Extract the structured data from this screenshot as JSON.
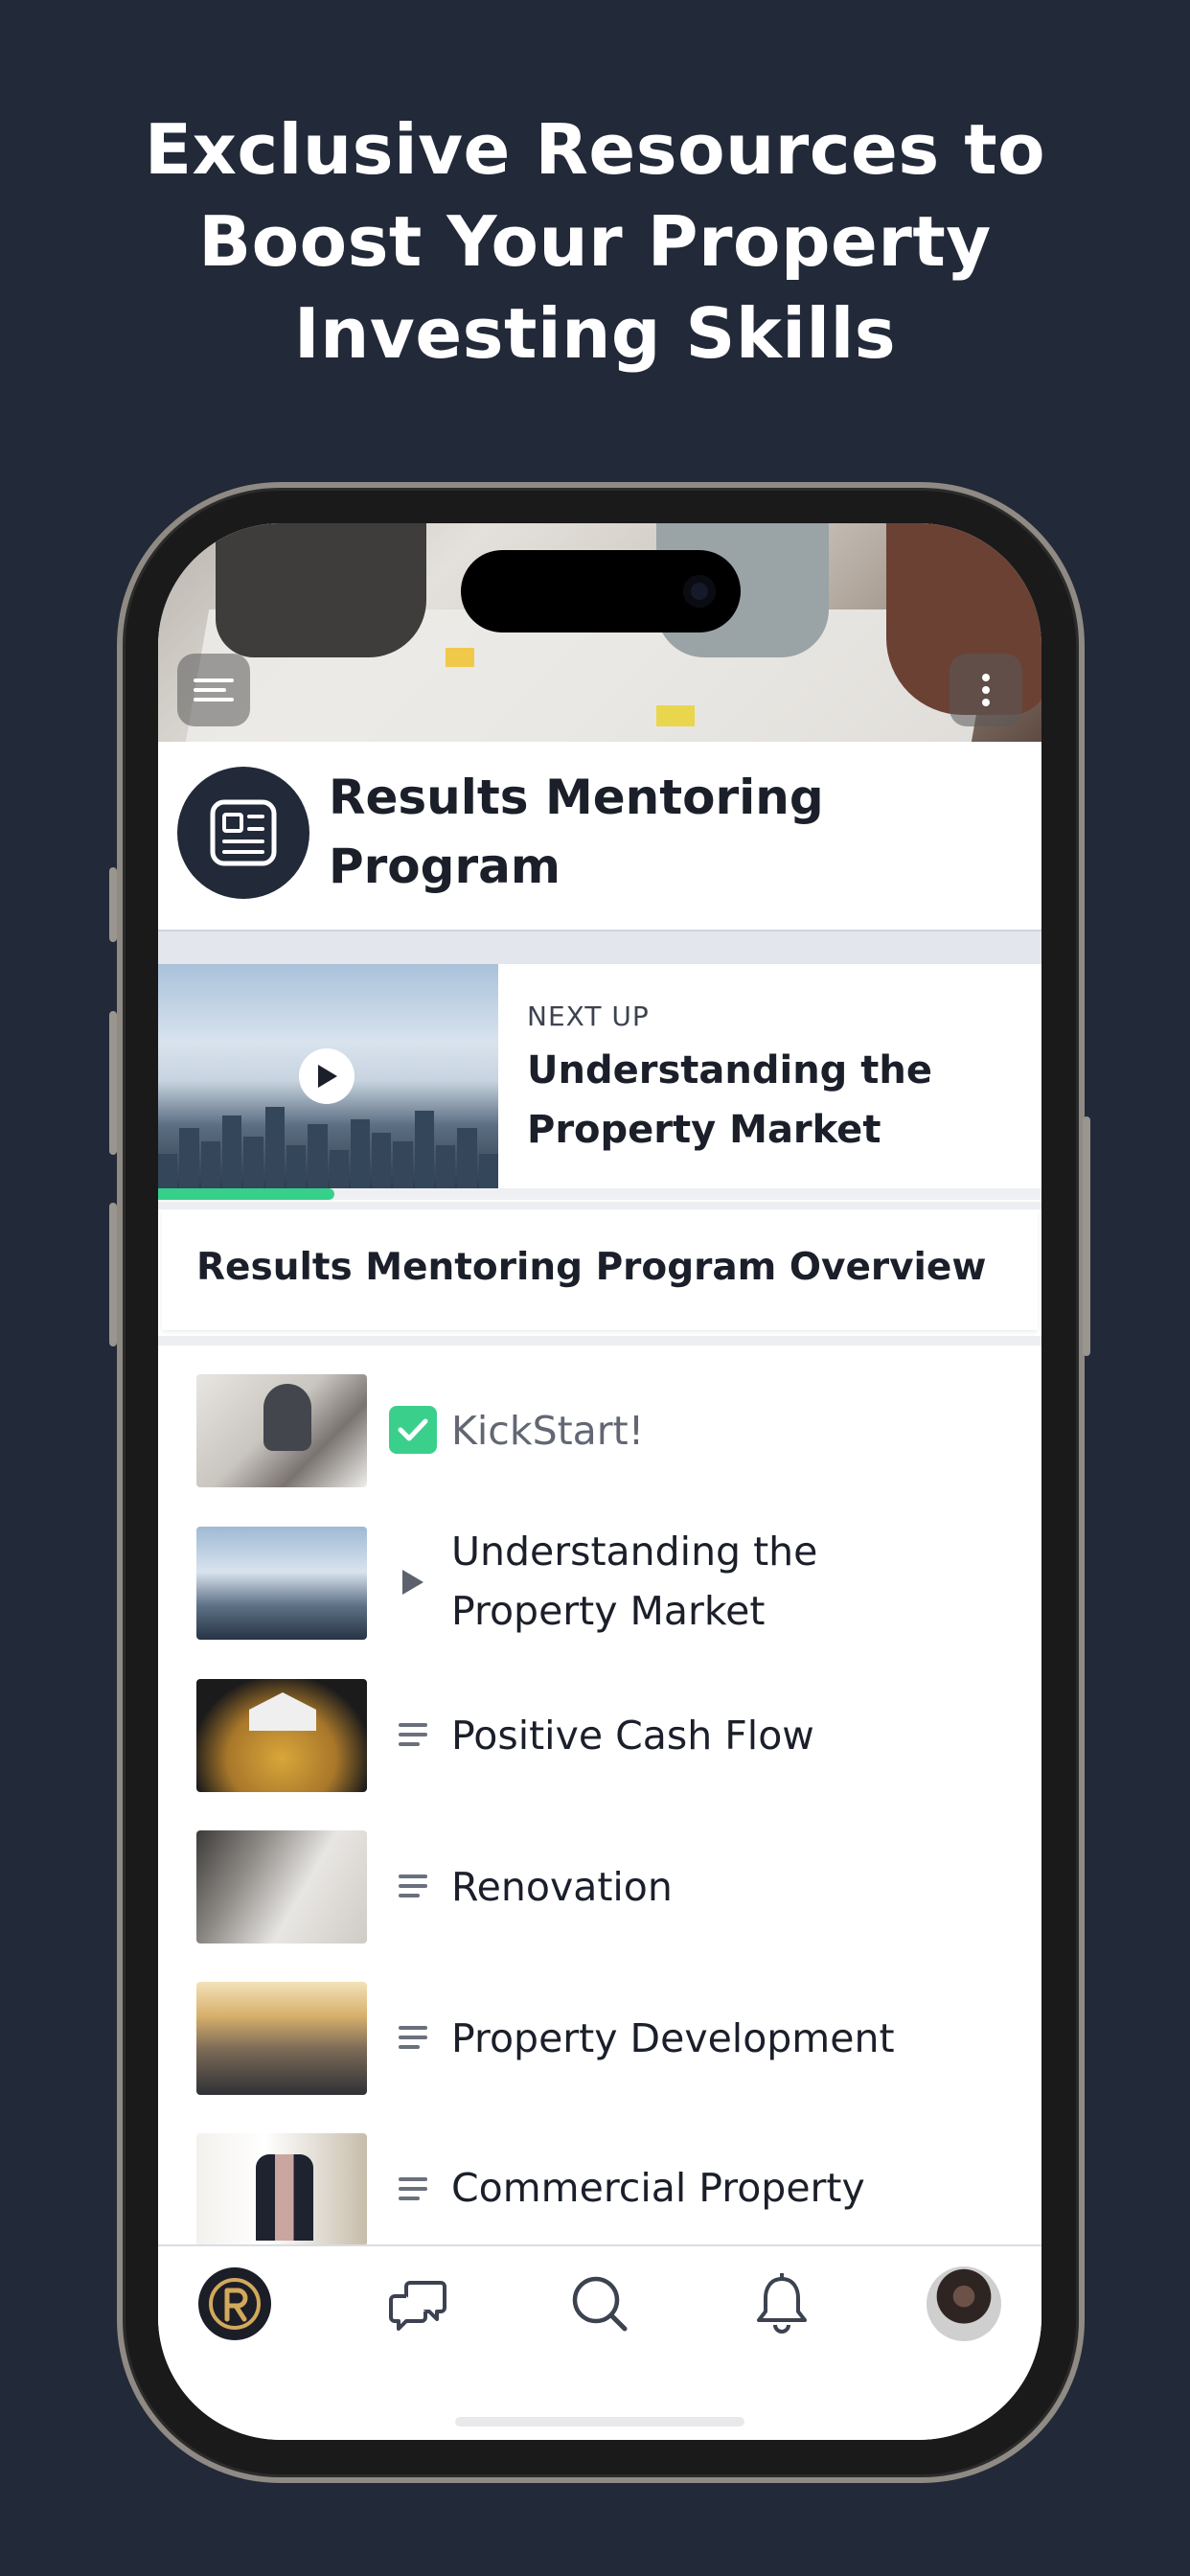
{
  "headline": {
    "line1": "Exclusive Resources to",
    "line2": "Boost Your Property",
    "line3": "Investing Skills"
  },
  "colors": {
    "background": "#222938",
    "accent_green": "#37d08a",
    "text_dark": "#1b1f2a"
  },
  "header": {
    "menu_icon": "hamburger-menu-icon",
    "more_icon": "vertical-dots-icon",
    "program_icon": "newspaper-icon",
    "title": "Results Mentoring Program"
  },
  "next_up": {
    "label": "NEXT UP",
    "title": "Understanding the Property Market",
    "progress": 0.2,
    "play_icon": "play-icon"
  },
  "overview": {
    "title": "Results Mentoring Program Overview"
  },
  "lessons": [
    {
      "title": "KickStart!",
      "state": "completed",
      "state_icon": "checkbox-checked-icon"
    },
    {
      "title": "Understanding the Property Market",
      "state": "video",
      "state_icon": "play-triangle-icon"
    },
    {
      "title": "Positive Cash Flow",
      "state": "text",
      "state_icon": "text-lines-icon"
    },
    {
      "title": "Renovation",
      "state": "text",
      "state_icon": "text-lines-icon"
    },
    {
      "title": "Property Development",
      "state": "text",
      "state_icon": "text-lines-icon"
    },
    {
      "title": "Commercial Property",
      "state": "text",
      "state_icon": "text-lines-icon"
    }
  ],
  "tabbar": {
    "items": [
      "home-logo-icon",
      "chat-icon",
      "search-icon",
      "bell-icon",
      "profile-avatar"
    ]
  }
}
